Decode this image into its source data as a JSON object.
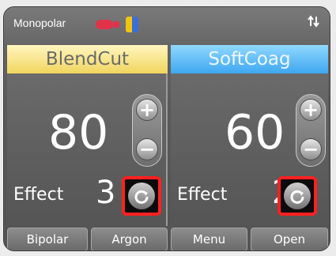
{
  "title": "Monopolar",
  "icons": {
    "connector": "connector-icon",
    "swap": "swap-arrows-icon",
    "reset": "reset-icon"
  },
  "colors": {
    "cut_mode": "#f1d55e",
    "coag_mode": "#3fa7f0",
    "highlight": "#ff2020"
  },
  "left_panel": {
    "mode": "BlendCut",
    "power": "80",
    "effect_label": "Effect",
    "effect_value": "3",
    "plus": "+",
    "minus": "−"
  },
  "right_panel": {
    "mode": "SoftCoag",
    "power": "60",
    "effect_label": "Effect",
    "effect_value": "2",
    "plus": "+",
    "minus": "−"
  },
  "bottom_buttons": {
    "bipolar": "Bipolar",
    "argon": "Argon",
    "menu": "Menu",
    "open": "Open"
  }
}
